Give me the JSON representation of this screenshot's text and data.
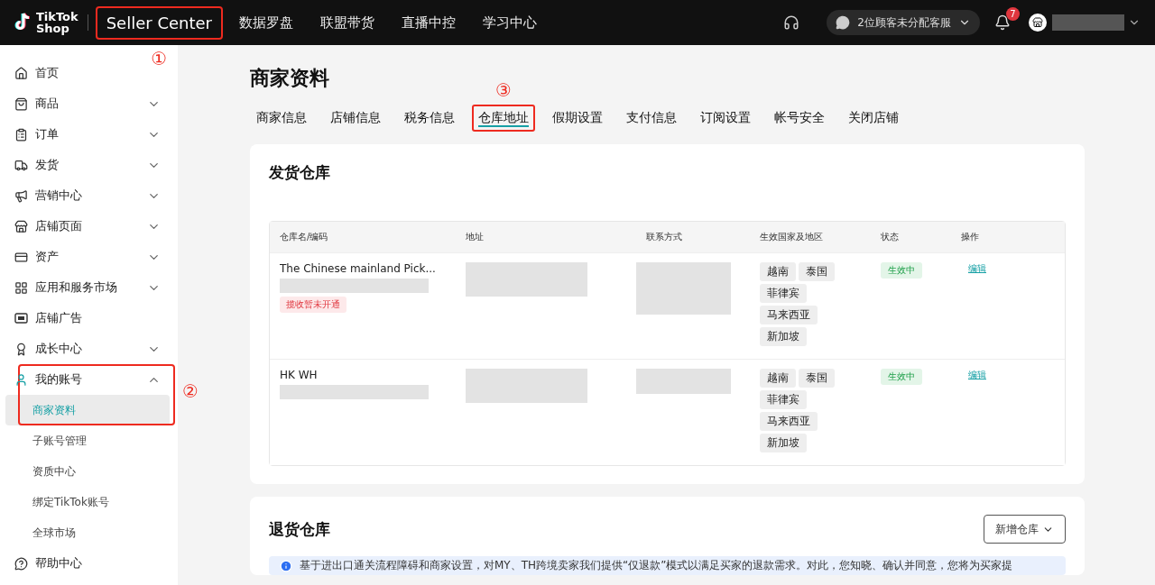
{
  "topbar": {
    "logo": {
      "line1": "TikTok",
      "line2": "Shop"
    },
    "nav": [
      {
        "label": "Seller Center",
        "selected": true,
        "highlighted": true,
        "callout": "①"
      },
      {
        "label": "数据罗盘",
        "selected": false,
        "highlighted": false
      },
      {
        "label": "联盟带货",
        "selected": false,
        "highlighted": false
      },
      {
        "label": "直播中控",
        "selected": false,
        "highlighted": false
      },
      {
        "label": "学习中心",
        "selected": false,
        "highlighted": false
      }
    ],
    "chat_pill": "2位顾客未分配客服",
    "notification_count": "7"
  },
  "sidebar": {
    "items": [
      {
        "label": "首页"
      },
      {
        "label": "商品",
        "expanded": false
      },
      {
        "label": "订单",
        "expanded": false
      },
      {
        "label": "发货",
        "expanded": false
      },
      {
        "label": "营销中心",
        "expanded": false
      },
      {
        "label": "店铺页面",
        "expanded": false
      },
      {
        "label": "资产",
        "expanded": false
      },
      {
        "label": "应用和服务市场",
        "expanded": false
      },
      {
        "label": "店铺广告"
      },
      {
        "label": "成长中心",
        "expanded": false
      },
      {
        "label": "我的账号",
        "expanded": true,
        "highlighted": true,
        "callout": "②",
        "children": [
          {
            "label": "商家资料",
            "selected": true
          },
          {
            "label": "子账号管理",
            "selected": false
          },
          {
            "label": "资质中心",
            "selected": false
          },
          {
            "label": "绑定TikTok账号",
            "selected": false
          },
          {
            "label": "全球市场",
            "selected": false
          }
        ]
      },
      {
        "label": "帮助中心"
      }
    ]
  },
  "page": {
    "title": "商家资料",
    "tabs": [
      {
        "label": "商家信息",
        "selected": false,
        "highlighted": false
      },
      {
        "label": "店铺信息",
        "selected": false,
        "highlighted": false
      },
      {
        "label": "税务信息",
        "selected": false,
        "highlighted": false
      },
      {
        "label": "仓库地址",
        "selected": true,
        "highlighted": true,
        "callout": "③"
      },
      {
        "label": "假期设置",
        "selected": false,
        "highlighted": false
      },
      {
        "label": "支付信息",
        "selected": false,
        "highlighted": false
      },
      {
        "label": "订阅设置",
        "selected": false,
        "highlighted": false
      },
      {
        "label": "帐号安全",
        "selected": false,
        "highlighted": false
      },
      {
        "label": "关闭店铺",
        "selected": false,
        "highlighted": false
      }
    ]
  },
  "shipping_warehouses": {
    "title": "发货仓库",
    "columns": [
      "仓库名/编码",
      "地址",
      "联系方式",
      "生效国家及地区",
      "状态",
      "操作"
    ],
    "rows": [
      {
        "name": "The Chinese mainland Pick...",
        "badge": "揽收暂未开通",
        "regions": [
          "越南",
          "泰国",
          "菲律宾",
          "马来西亚",
          "新加坡"
        ],
        "status": "生效中",
        "action": "编辑"
      },
      {
        "name": "HK WH",
        "regions": [
          "越南",
          "泰国",
          "菲律宾",
          "马来西亚",
          "新加坡"
        ],
        "status": "生效中",
        "action": "编辑"
      }
    ]
  },
  "return_warehouses": {
    "title": "退货仓库",
    "add_button": "新增仓库",
    "notice": "基于进出口通关流程障碍和商家设置，对MY、TH跨境卖家我们提供“仅退款”模式以满足买家的退款需求。对此，您知晓、确认并同意，您将为买家提"
  }
}
